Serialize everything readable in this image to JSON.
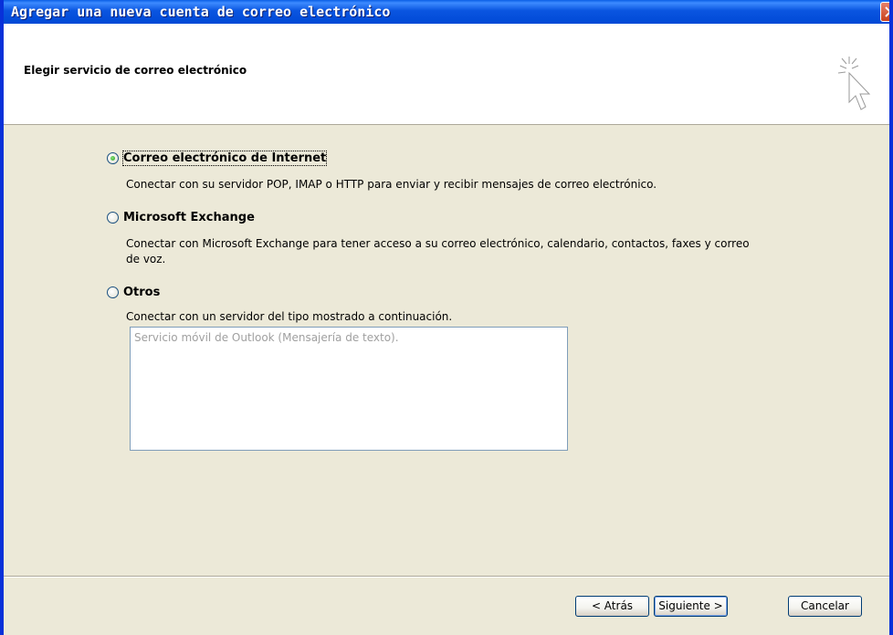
{
  "window": {
    "title": "Agregar una nueva cuenta de correo electrónico"
  },
  "header": {
    "title": "Elegir servicio de correo electrónico",
    "icon": "wizard-cursor-sparkle-icon"
  },
  "options": [
    {
      "label": "Correo electrónico de Internet",
      "description": "Conectar con su servidor POP, IMAP o HTTP para enviar y recibir mensajes de correo electrónico.",
      "selected": true
    },
    {
      "label": "Microsoft Exchange",
      "description_line1": "Conectar con Microsoft Exchange para tener acceso a su correo electrónico, calendario, contactos, faxes y correo",
      "description_line2": "de voz.",
      "selected": false
    },
    {
      "label": "Otros",
      "description": "Conectar con un servidor del tipo mostrado a continuación.",
      "selected": false,
      "list_items": [
        "Servicio móvil de Outlook (Mensajería de texto)."
      ]
    }
  ],
  "buttons": {
    "back": "< Atrás",
    "next": "Siguiente >",
    "cancel": "Cancelar"
  },
  "colors": {
    "titlebar": "#0A55E0",
    "dialog_bg": "#ECE9D8",
    "close_button": "#C8421E"
  }
}
